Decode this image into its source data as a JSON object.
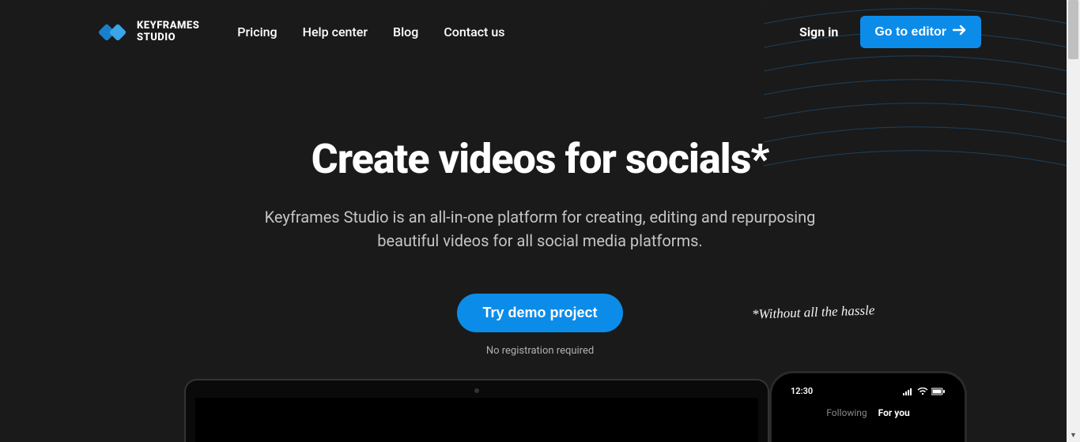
{
  "brand": {
    "line1": "KEYFRAMES",
    "line2": "STUDIO"
  },
  "nav": {
    "pricing": "Pricing",
    "help_center": "Help center",
    "blog": "Blog",
    "contact": "Contact us"
  },
  "header": {
    "signin": "Sign in",
    "cta": "Go to editor"
  },
  "hero": {
    "title": "Create videos for socials*",
    "subtitle": "Keyframes Studio is an all-in-one platform for creating, editing and repurposing beautiful videos for all social media platforms.",
    "annotation": "*Without all the hassle",
    "demo_button": "Try demo project",
    "note": "No registration required"
  },
  "phone": {
    "time": "12:30",
    "tab_following": "Following",
    "tab_foryou": "For you"
  },
  "colors": {
    "accent": "#0c8ce9",
    "background": "#1a1a1a"
  }
}
